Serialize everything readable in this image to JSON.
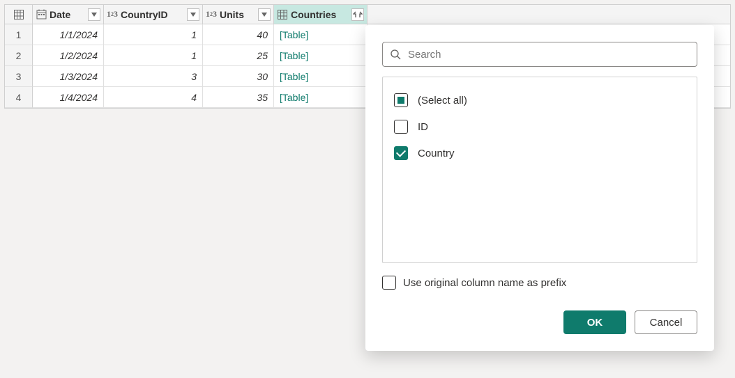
{
  "grid": {
    "columns": [
      {
        "name": "Date",
        "type": "date",
        "width": "col-date"
      },
      {
        "name": "CountryID",
        "type": "number",
        "width": "col-countryid"
      },
      {
        "name": "Units",
        "type": "number",
        "width": "col-units"
      },
      {
        "name": "Countries",
        "type": "table",
        "width": "col-countries",
        "selected": true,
        "expand": true
      }
    ],
    "rows": [
      {
        "num": "1",
        "Date": "1/1/2024",
        "CountryID": "1",
        "Units": "40",
        "Countries": "[Table]"
      },
      {
        "num": "2",
        "Date": "1/2/2024",
        "CountryID": "1",
        "Units": "25",
        "Countries": "[Table]"
      },
      {
        "num": "3",
        "Date": "1/3/2024",
        "CountryID": "3",
        "Units": "30",
        "Countries": "[Table]"
      },
      {
        "num": "4",
        "Date": "1/4/2024",
        "CountryID": "4",
        "Units": "35",
        "Countries": "[Table]"
      }
    ]
  },
  "panel": {
    "search_placeholder": "Search",
    "options": {
      "select_all": {
        "label": "(Select all)",
        "state": "indeterminate"
      },
      "id": {
        "label": "ID",
        "state": "off"
      },
      "country": {
        "label": "Country",
        "state": "on"
      }
    },
    "prefix_label": "Use original column name as prefix",
    "prefix_checked": false,
    "ok_label": "OK",
    "cancel_label": "Cancel"
  }
}
